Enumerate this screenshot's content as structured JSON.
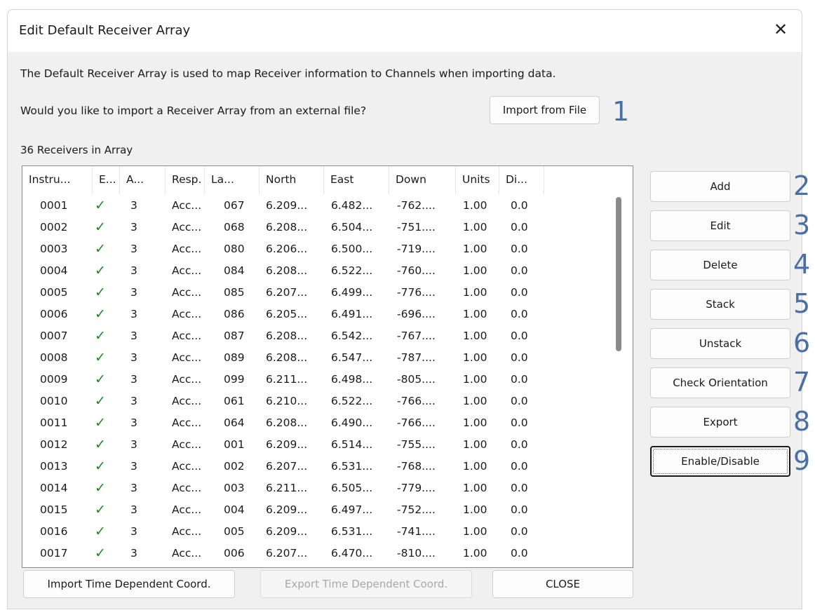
{
  "window": {
    "title": "Edit Default Receiver Array",
    "close_glyph": "✕"
  },
  "description": "The Default Receiver Array is used to map Receiver information to Channels when importing data.",
  "import_prompt": "Would you like to import a Receiver Array from an external file?",
  "import_button": "Import from File",
  "count_label": "36 Receivers in Array",
  "columns": [
    "Instru...",
    "E...",
    "A...",
    "Resp.",
    "La...",
    "North",
    "East",
    "Down",
    "Units",
    "Di..."
  ],
  "rows": [
    [
      "0001",
      "✓",
      "3",
      "Acc...",
      "067",
      "6.209...",
      "6.482...",
      "-762....",
      "1.00",
      "0.0"
    ],
    [
      "0002",
      "✓",
      "3",
      "Acc...",
      "068",
      "6.208...",
      "6.504...",
      "-751....",
      "1.00",
      "0.0"
    ],
    [
      "0003",
      "✓",
      "3",
      "Acc...",
      "080",
      "6.206...",
      "6.500...",
      "-719....",
      "1.00",
      "0.0"
    ],
    [
      "0004",
      "✓",
      "3",
      "Acc...",
      "084",
      "6.208...",
      "6.522...",
      "-760....",
      "1.00",
      "0.0"
    ],
    [
      "0005",
      "✓",
      "3",
      "Acc...",
      "085",
      "6.207...",
      "6.499...",
      "-776....",
      "1.00",
      "0.0"
    ],
    [
      "0006",
      "✓",
      "3",
      "Acc...",
      "086",
      "6.205...",
      "6.491...",
      "-696....",
      "1.00",
      "0.0"
    ],
    [
      "0007",
      "✓",
      "3",
      "Acc...",
      "087",
      "6.208...",
      "6.542...",
      "-767....",
      "1.00",
      "0.0"
    ],
    [
      "0008",
      "✓",
      "3",
      "Acc...",
      "089",
      "6.208...",
      "6.547...",
      "-787....",
      "1.00",
      "0.0"
    ],
    [
      "0009",
      "✓",
      "3",
      "Acc...",
      "099",
      "6.211...",
      "6.498...",
      "-805....",
      "1.00",
      "0.0"
    ],
    [
      "0010",
      "✓",
      "3",
      "Acc...",
      "061",
      "6.210...",
      "6.522...",
      "-766....",
      "1.00",
      "0.0"
    ],
    [
      "0011",
      "✓",
      "3",
      "Acc...",
      "064",
      "6.208...",
      "6.490...",
      "-766....",
      "1.00",
      "0.0"
    ],
    [
      "0012",
      "✓",
      "3",
      "Acc...",
      "001",
      "6.209...",
      "6.514...",
      "-755....",
      "1.00",
      "0.0"
    ],
    [
      "0013",
      "✓",
      "3",
      "Acc...",
      "002",
      "6.207...",
      "6.531...",
      "-768....",
      "1.00",
      "0.0"
    ],
    [
      "0014",
      "✓",
      "3",
      "Acc...",
      "003",
      "6.211...",
      "6.505...",
      "-779....",
      "1.00",
      "0.0"
    ],
    [
      "0015",
      "✓",
      "3",
      "Acc...",
      "004",
      "6.209...",
      "6.497...",
      "-752....",
      "1.00",
      "0.0"
    ],
    [
      "0016",
      "✓",
      "3",
      "Acc...",
      "005",
      "6.209...",
      "6.531...",
      "-741....",
      "1.00",
      "0.0"
    ],
    [
      "0017",
      "✓",
      "3",
      "Acc...",
      "006",
      "6.207...",
      "6.470...",
      "-810....",
      "1.00",
      "0.0"
    ]
  ],
  "side_buttons": [
    "Add",
    "Edit",
    "Delete",
    "Stack",
    "Unstack",
    "Check Orientation",
    "Export",
    "Enable/Disable"
  ],
  "callouts": [
    "1",
    "2",
    "3",
    "4",
    "5",
    "6",
    "7",
    "8",
    "9"
  ],
  "bottom_buttons": {
    "import_time": "Import Time Dependent Coord.",
    "export_time": "Export Time Dependent Coord.",
    "close": "CLOSE"
  },
  "colors": {
    "callout": "#4a6fa5",
    "check": "#1c8a24"
  }
}
